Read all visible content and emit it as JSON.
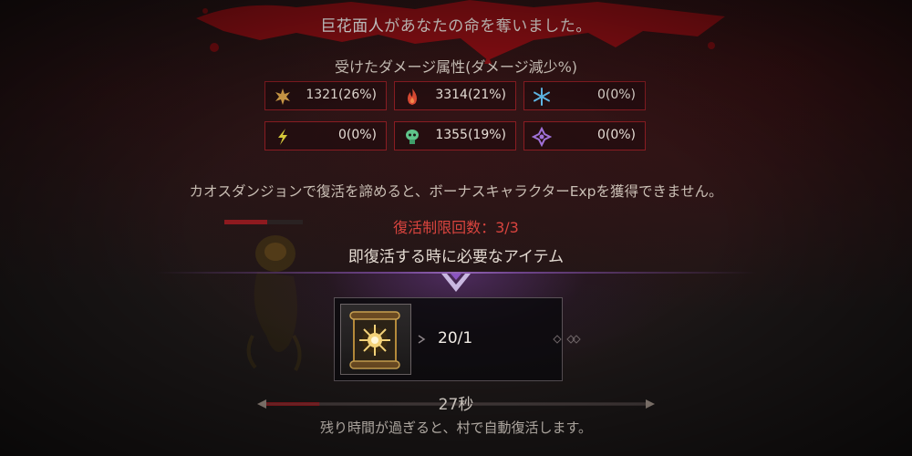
{
  "death_message": {
    "enemy_name": "巨花面人",
    "suffix": "があなたの命を奪いました。"
  },
  "damage_section": {
    "title": "受けたダメージ属性(ダメージ減少%)",
    "cells": [
      {
        "icon": "physical-icon",
        "value": "1321(26%)",
        "color": "#d8a24a"
      },
      {
        "icon": "fire-icon",
        "value": "3314(21%)",
        "color": "#d94a33"
      },
      {
        "icon": "ice-icon",
        "value": "0(0%)",
        "color": "#5fb7e6"
      },
      {
        "icon": "lightning-icon",
        "value": "0(0%)",
        "color": "#d6c83a"
      },
      {
        "icon": "poison-icon",
        "value": "1355(19%)",
        "color": "#5fc48a"
      },
      {
        "icon": "magic-icon",
        "value": "0(0%)",
        "color": "#a071d8"
      }
    ]
  },
  "warning": "カオスダンジョンで復活を諦めると、ボーナスキャラクターExpを獲得できません。",
  "revive_limit": "復活制限回数：3/3",
  "required_item_title": "即復活する時に必要なアイテム",
  "item": {
    "icon": "revive-scroll-icon",
    "count": "20/1"
  },
  "timer": {
    "label": "27秒",
    "progress": 0.14,
    "message": "残り時間が過ぎると、村で自動復活します。"
  },
  "colors": {
    "blood": "#8e0f14",
    "border": "#8a1c22",
    "accent_purple": "#8a55c0",
    "limit_red": "#d8443e"
  }
}
